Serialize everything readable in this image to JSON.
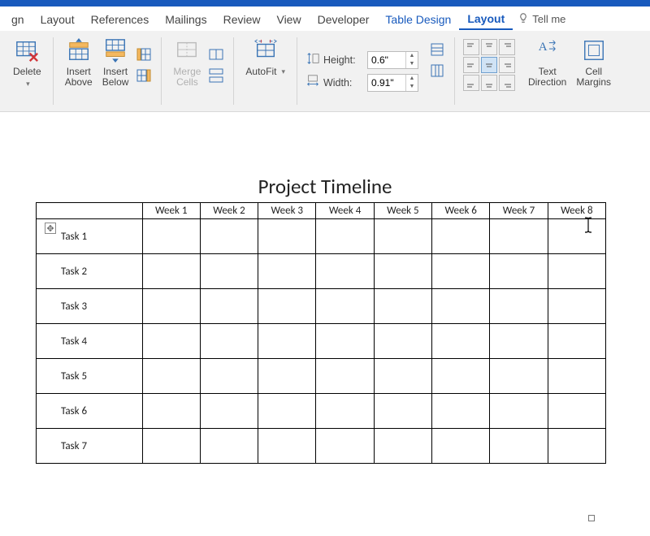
{
  "tabs": {
    "partial": "gn",
    "layout": "Layout",
    "references": "References",
    "mailings": "Mailings",
    "review": "Review",
    "view": "View",
    "developer": "Developer",
    "table_design": "Table Design",
    "table_layout": "Layout",
    "tell_me": "Tell me"
  },
  "ribbon": {
    "delete": "Delete",
    "insert_above": "Insert\nAbove",
    "insert_below": "Insert\nBelow",
    "merge_cells": "Merge\nCells",
    "autofit": "AutoFit",
    "height_label": "Height:",
    "height_value": "0.6\"",
    "width_label": "Width:",
    "width_value": "0.91\"",
    "text_direction": "Text\nDirection",
    "cell_margins": "Cell\nMargins"
  },
  "document": {
    "title": "Project Timeline",
    "columns": [
      "",
      "Week 1",
      "Week 2",
      "Week 3",
      "Week 4",
      "Week 5",
      "Week 6",
      "Week 7",
      "Week 8"
    ],
    "rows": [
      "Task 1",
      "Task 2",
      "Task 3",
      "Task 4",
      "Task 5",
      "Task 6",
      "Task 7"
    ]
  }
}
